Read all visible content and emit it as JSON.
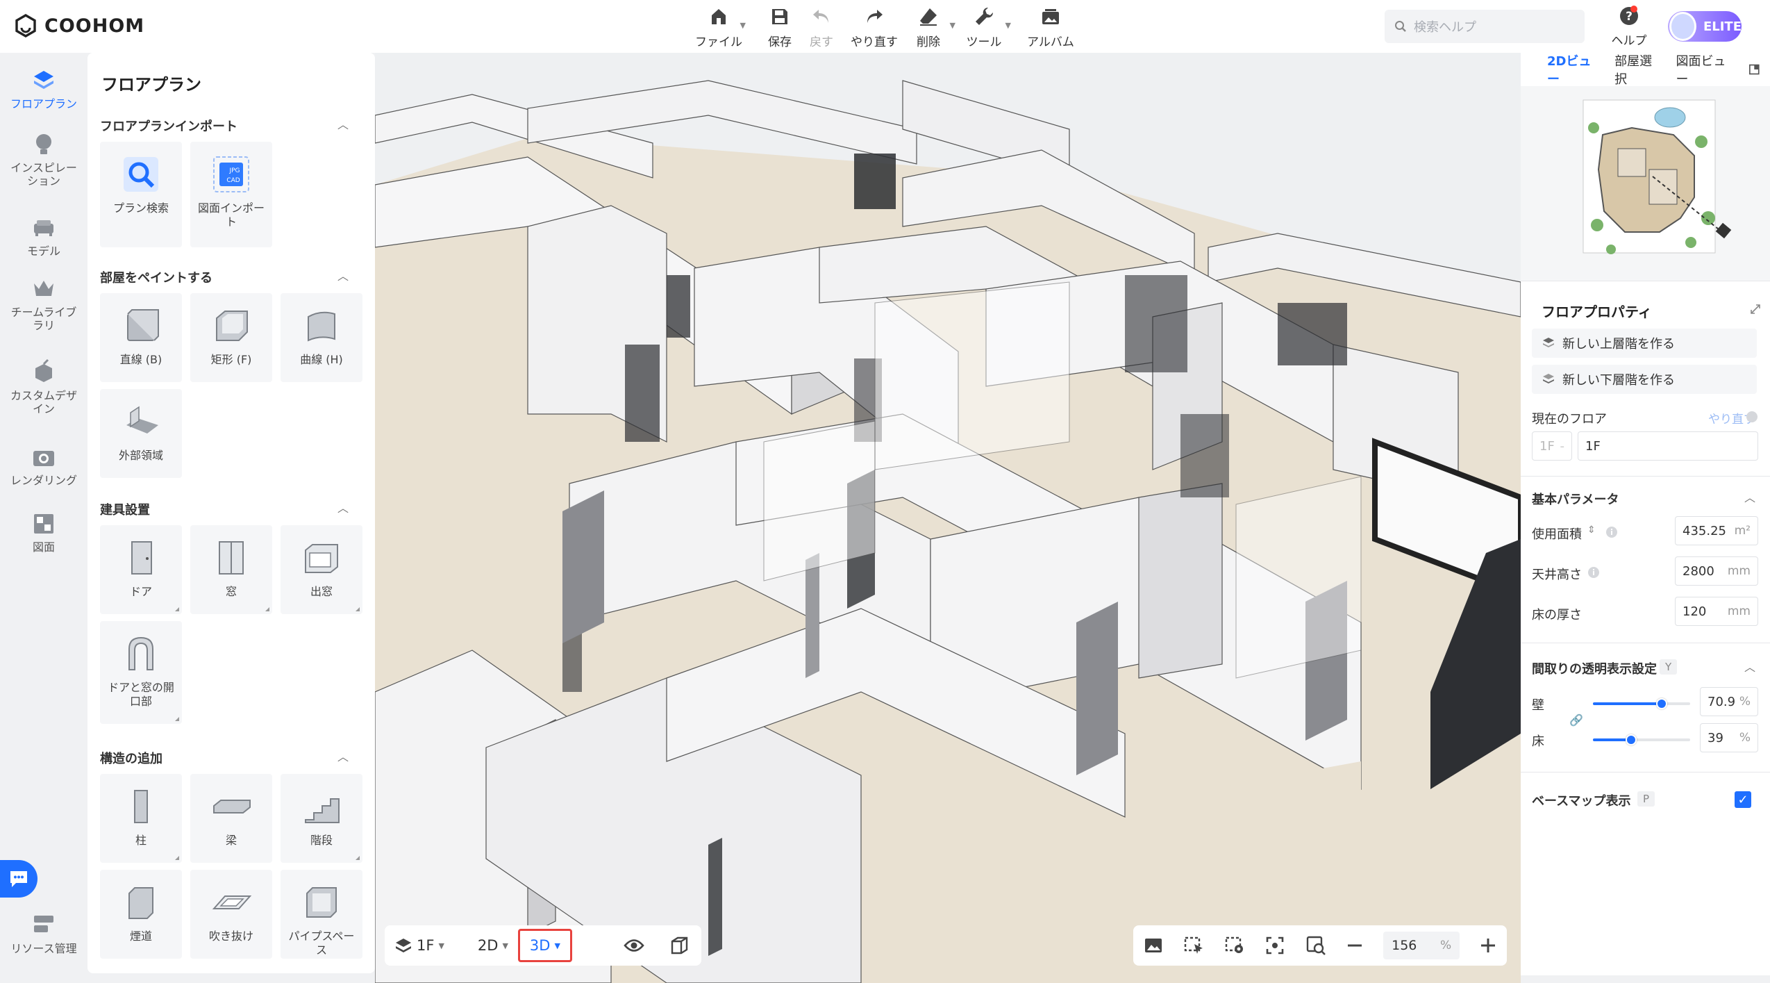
{
  "app": {
    "brand": "COOHOM"
  },
  "toolbar": {
    "file": "ファイル",
    "save": "保存",
    "undo": "戻す",
    "redo": "やり直す",
    "delete": "削除",
    "tools": "ツール",
    "album": "アルバム"
  },
  "search": {
    "placeholder": "検索ヘルプ"
  },
  "help": {
    "label": "ヘルプ"
  },
  "account": {
    "badge": "ELITE"
  },
  "nav": {
    "floorplan": "フロアプラン",
    "inspiration": "インスピレーション",
    "model": "モデル",
    "team_library": "チームライブラリ",
    "custom_design": "カスタムデザイン",
    "rendering": "レンダリング",
    "drawing": "図面",
    "resources": "リソース管理"
  },
  "panel": {
    "title": "フロアプラン",
    "import": {
      "header": "フロアプランインポート",
      "plan_search": "プラン検索",
      "drawing_import": "図面インポート",
      "jpg": "JPG",
      "cad": "CAD"
    },
    "paint": {
      "header": "部屋をペイントする",
      "straight": "直線 (B)",
      "rect": "矩形 (F)",
      "curve": "曲線 (H)",
      "exterior": "外部領域"
    },
    "openings": {
      "header": "建具設置",
      "door": "ドア",
      "window": "窓",
      "bay_window": "出窓",
      "door_window_opening": "ドアと窓の開口部"
    },
    "structure": {
      "header": "構造の追加",
      "column": "柱",
      "beam": "梁",
      "stairs": "階段",
      "chimney": "煙道",
      "void": "吹き抜け",
      "pipe_space": "パイプスペース"
    }
  },
  "bottom": {
    "floor": "1F",
    "view2d": "2D",
    "view3d": "3D",
    "zoom": "156",
    "zoom_unit": "%"
  },
  "right": {
    "tabs": [
      "2Dビュー",
      "部屋選択",
      "図面ビュー"
    ],
    "properties_title": "フロアプロパティ",
    "new_upper": "新しい上層階を作る",
    "new_lower": "新しい下層階を作る",
    "current_floor": "現在のフロア",
    "redo_link": "やり直す",
    "floor_prefix": "1F",
    "floor_name": "1F",
    "basic_params": "基本パラメータ",
    "area_label": "使用面積",
    "area_value": "435.25",
    "area_unit": "m²",
    "ceiling_label": "天井高さ",
    "ceiling_value": "2800",
    "floor_thick_label": "床の厚さ",
    "floor_thick_value": "120",
    "mm": "mm",
    "transparency_title": "間取りの透明表示設定",
    "transparency_key": "Y",
    "wall_label": "壁",
    "wall_value": "70.9",
    "wall_level": 0.709,
    "floor_label": "床",
    "floor_value": "39",
    "floor_level": 0.39,
    "pct": "%",
    "basemap_label": "ベースマップ表示",
    "basemap_key": "P",
    "basemap_on": true
  },
  "colors": {
    "accent": "#1f6fff",
    "highlight": "#e8433e",
    "floor_wood": "#e9e1d2",
    "wall": "#f7f7f8"
  }
}
